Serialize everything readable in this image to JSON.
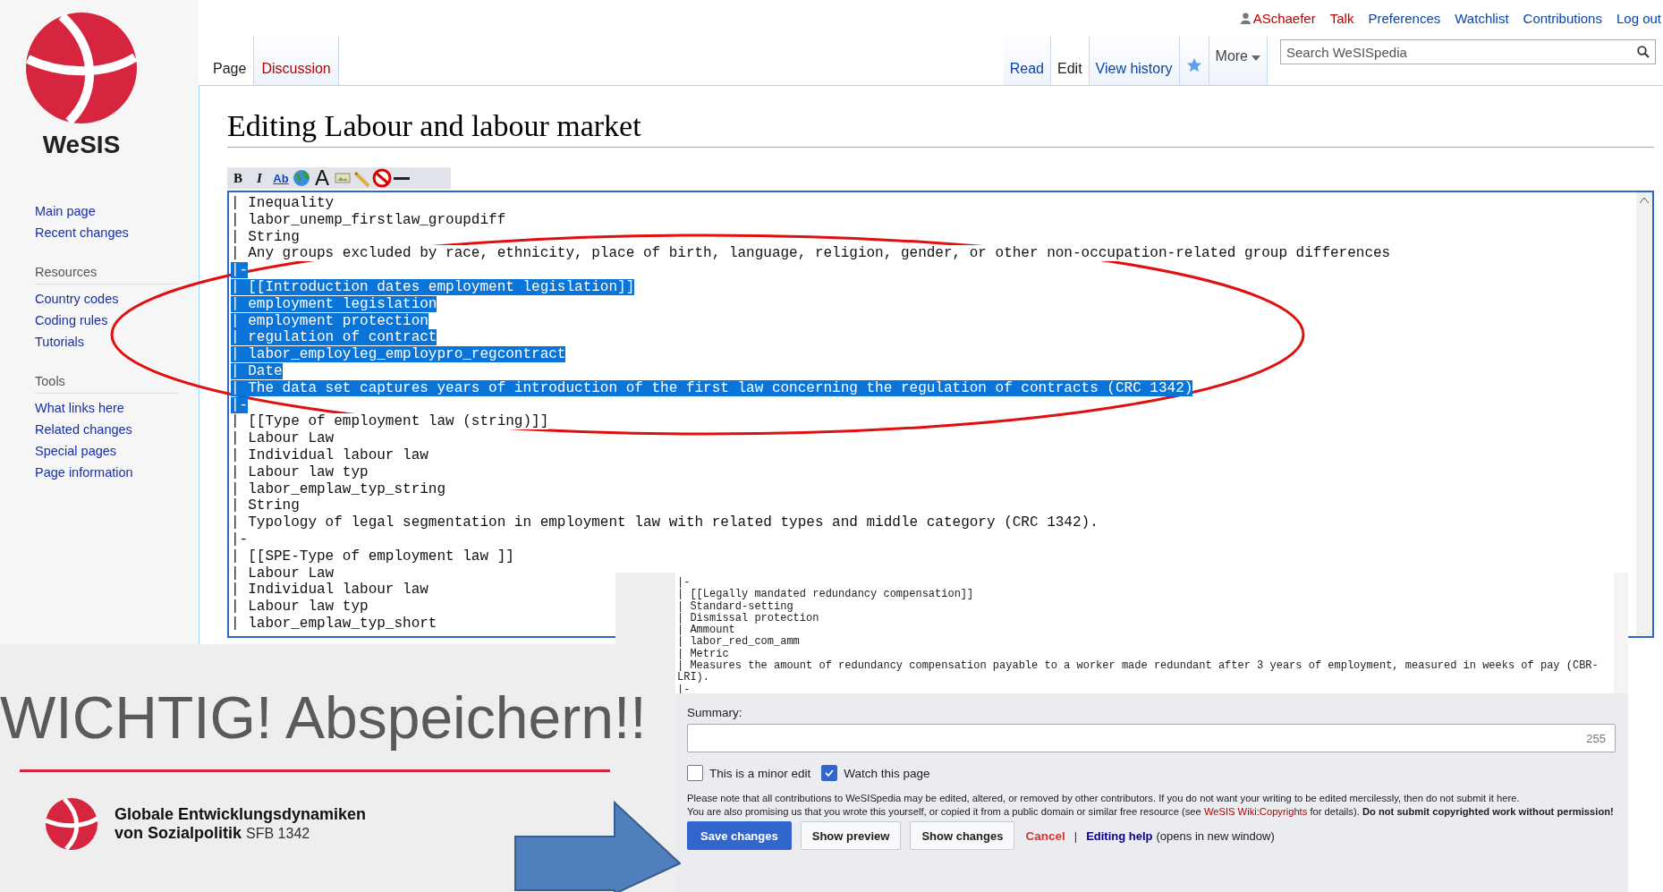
{
  "logo": {
    "text": "WeSIS"
  },
  "personal_tools": [
    {
      "label": "ASchaefer",
      "new": true,
      "kind": "user"
    },
    {
      "label": "Talk",
      "new": true,
      "kind": "link"
    },
    {
      "label": "Preferences",
      "new": false,
      "kind": "link"
    },
    {
      "label": "Watchlist",
      "new": false,
      "kind": "link"
    },
    {
      "label": "Contributions",
      "new": false,
      "kind": "link"
    },
    {
      "label": "Log out",
      "new": false,
      "kind": "link"
    }
  ],
  "sidebar": {
    "sections": [
      {
        "items": [
          "Main page",
          "Recent changes"
        ]
      },
      {
        "heading": "Resources",
        "items": [
          "Country codes",
          "Coding rules",
          "Tutorials"
        ]
      },
      {
        "heading": "Tools",
        "items": [
          "What links here",
          "Related changes",
          "Special pages",
          "Page information"
        ]
      }
    ]
  },
  "tabs_left": [
    {
      "label": "Page",
      "selected": true,
      "new": false
    },
    {
      "label": "Discussion",
      "selected": false,
      "new": true
    }
  ],
  "tabs_right": [
    {
      "label": "Read",
      "selected": false
    },
    {
      "label": "Edit",
      "selected": true
    },
    {
      "label": "View history",
      "selected": false
    }
  ],
  "more": "More",
  "search": {
    "placeholder": "Search WeSISpedia"
  },
  "heading": "Editing Labour and labour market",
  "toolbar": [
    {
      "kind": "bold",
      "label": "B"
    },
    {
      "kind": "italic",
      "label": "I"
    },
    {
      "kind": "link",
      "label": "Ab"
    },
    {
      "kind": "globe"
    },
    {
      "kind": "headline",
      "label": "A"
    },
    {
      "kind": "image"
    },
    {
      "kind": "pen"
    },
    {
      "kind": "nowiki"
    },
    {
      "kind": "rule"
    }
  ],
  "editor": {
    "lines": [
      {
        "text": "| Inequality",
        "selected": false
      },
      {
        "text": "| labor_unemp_firstlaw_groupdiff",
        "selected": false
      },
      {
        "text": "| String",
        "selected": false
      },
      {
        "text": "| Any groups excluded by race, ethnicity, place of birth, language, religion, gender, or other non-occupation-related group differences",
        "selected": false
      },
      {
        "text": "|-",
        "selected": true
      },
      {
        "text": "| [[Introduction dates employment legislation]]",
        "selected": true
      },
      {
        "text": "| employment legislation",
        "selected": true
      },
      {
        "text": "| employment protection",
        "selected": true
      },
      {
        "text": "| regulation of contract",
        "selected": true
      },
      {
        "text": "| labor_employleg_employpro_regcontract",
        "selected": true
      },
      {
        "text": "| Date",
        "selected": true
      },
      {
        "text": "| The data set captures years of introduction of the first law concerning the regulation of contracts (CRC 1342)",
        "selected": true
      },
      {
        "text": "|-",
        "selected": true
      },
      {
        "text": "| [[Type of employment law (string)]]",
        "selected": false
      },
      {
        "text": "| Labour Law",
        "selected": false
      },
      {
        "text": "| Individual labour law",
        "selected": false
      },
      {
        "text": "| Labour law typ",
        "selected": false
      },
      {
        "text": "| labor_emplaw_typ_string",
        "selected": false
      },
      {
        "text": "| String",
        "selected": false
      },
      {
        "text": "| Typology of legal segmentation in employment law with related types and middle category (CRC 1342).",
        "selected": false
      },
      {
        "text": "|-",
        "selected": false
      },
      {
        "text": "| [[SPE-Type of employment law ]]",
        "selected": false
      },
      {
        "text": "| Labour Law",
        "selected": false
      },
      {
        "text": "| Individual labour law",
        "selected": false
      },
      {
        "text": "| Labour law typ",
        "selected": false
      },
      {
        "text": "| labor_emplaw_typ_short",
        "selected": false
      }
    ]
  },
  "slide": {
    "title": "WICHTIG! Abspeichern!!",
    "brand_line1": "Globale Entwicklungsdynamiken",
    "brand_line2": "von Sozialpolitik",
    "brand_tag": "SFB 1342"
  },
  "inset": {
    "lines": [
      "|-",
      "| [[Legally mandated redundancy compensation]]",
      "| Standard-setting",
      "| Dismissal protection",
      "| Ammount",
      "| labor_red_com_amm",
      "| Metric",
      "| Measures the amount of redundancy compensation payable to a worker made redundant after 3 years of employment, measured in weeks of pay (CBR-",
      "LRI).",
      "|-"
    ],
    "summary_label": "Summary:",
    "summary_counter": "255",
    "checkboxes": [
      {
        "label": "This is a minor edit",
        "checked": false
      },
      {
        "label": "Watch this page",
        "checked": true
      }
    ],
    "notice_line1": "Please note that all contributions to WeSISpedia may be edited, altered, or removed by other contributors. If you do not want your writing to be edited mercilessly, then do not submit it here.",
    "notice_before": "You are also promising us that you wrote this yourself, or copied it from a public domain or similar free resource (see",
    "notice_link": "WeSIS Wiki:Copyrights",
    "notice_after": "for details). **Do not submit copyrighted work without permission!**",
    "buttons": [
      {
        "label": "Save changes",
        "kind": "primary"
      },
      {
        "label": "Show preview",
        "kind": "normal"
      },
      {
        "label": "Show changes",
        "kind": "normal"
      }
    ],
    "cancel": "Cancel",
    "separator": "|",
    "help_link": "Editing help",
    "help_note": "(opens in new window)"
  }
}
